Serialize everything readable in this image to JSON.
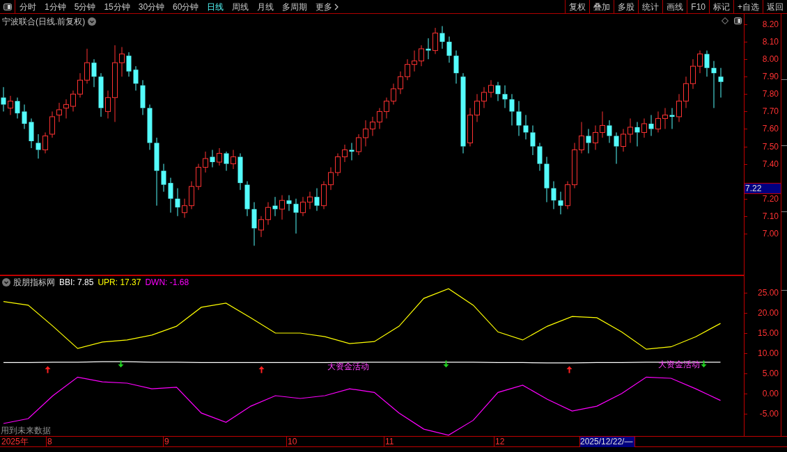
{
  "toolbar": {
    "periods": [
      {
        "label": "分时",
        "selected": false
      },
      {
        "label": "1分钟",
        "selected": false
      },
      {
        "label": "5分钟",
        "selected": false
      },
      {
        "label": "15分钟",
        "selected": false
      },
      {
        "label": "30分钟",
        "selected": false
      },
      {
        "label": "60分钟",
        "selected": false
      },
      {
        "label": "日线",
        "selected": true
      },
      {
        "label": "周线",
        "selected": false
      },
      {
        "label": "月线",
        "selected": false
      },
      {
        "label": "多周期",
        "selected": false
      },
      {
        "label": "更多",
        "selected": false
      }
    ],
    "buttons": [
      "复权",
      "叠加",
      "多股",
      "统计",
      "画线",
      "F10",
      "标记",
      "+自选",
      "返回"
    ]
  },
  "price_pane": {
    "title": "宁波联合(日线.前复权)",
    "current_price": "7.22",
    "chart_data": {
      "type": "candlestick",
      "ylim": [
        6.76,
        8.26
      ],
      "yticks": [
        {
          "value": 8.2,
          "label": "8.20"
        },
        {
          "value": 8.1,
          "label": "8.10"
        },
        {
          "value": 8.0,
          "label": "8.00"
        },
        {
          "value": 7.9,
          "label": "7.90"
        },
        {
          "value": 7.8,
          "label": "7.80"
        },
        {
          "value": 7.7,
          "label": "7.70"
        },
        {
          "value": 7.6,
          "label": "7.60"
        },
        {
          "value": 7.5,
          "label": "7.50"
        },
        {
          "value": 7.4,
          "label": "7.40"
        },
        {
          "value": 7.2,
          "label": "7.20"
        },
        {
          "value": 7.1,
          "label": "7.10"
        },
        {
          "value": 7.0,
          "label": "7.00"
        }
      ],
      "ohlc": [
        [
          7.78,
          7.84,
          7.7,
          7.74
        ],
        [
          7.72,
          7.79,
          7.68,
          7.76
        ],
        [
          7.76,
          7.78,
          7.66,
          7.69
        ],
        [
          7.7,
          7.74,
          7.6,
          7.63
        ],
        [
          7.64,
          7.66,
          7.49,
          7.53
        ],
        [
          7.52,
          7.57,
          7.43,
          7.48
        ],
        [
          7.48,
          7.58,
          7.46,
          7.56
        ],
        [
          7.57,
          7.7,
          7.55,
          7.67
        ],
        [
          7.68,
          7.75,
          7.64,
          7.71
        ],
        [
          7.72,
          7.77,
          7.66,
          7.74
        ],
        [
          7.73,
          7.82,
          7.7,
          7.8
        ],
        [
          7.8,
          7.92,
          7.78,
          7.88
        ],
        [
          7.88,
          8.06,
          7.86,
          7.98
        ],
        [
          7.98,
          8.0,
          7.84,
          7.9
        ],
        [
          7.9,
          7.92,
          7.67,
          7.72
        ],
        [
          7.7,
          7.82,
          7.66,
          7.78
        ],
        [
          7.78,
          8.08,
          7.64,
          7.98
        ],
        [
          7.98,
          8.07,
          7.9,
          8.03
        ],
        [
          8.02,
          8.04,
          7.9,
          7.93
        ],
        [
          7.94,
          7.96,
          7.82,
          7.86
        ],
        [
          7.85,
          7.88,
          7.68,
          7.72
        ],
        [
          7.72,
          7.74,
          7.48,
          7.52
        ],
        [
          7.52,
          7.55,
          7.16,
          7.36
        ],
        [
          7.36,
          7.4,
          7.24,
          7.28
        ],
        [
          7.29,
          7.32,
          7.12,
          7.2
        ],
        [
          7.2,
          7.26,
          7.1,
          7.15
        ],
        [
          7.12,
          7.2,
          7.09,
          7.16
        ],
        [
          7.16,
          7.3,
          7.14,
          7.27
        ],
        [
          7.27,
          7.4,
          7.25,
          7.38
        ],
        [
          7.38,
          7.47,
          7.35,
          7.43
        ],
        [
          7.44,
          7.48,
          7.38,
          7.41
        ],
        [
          7.41,
          7.49,
          7.39,
          7.46
        ],
        [
          7.46,
          7.47,
          7.36,
          7.4
        ],
        [
          7.4,
          7.48,
          7.37,
          7.44
        ],
        [
          7.44,
          7.46,
          7.25,
          7.29
        ],
        [
          7.28,
          7.3,
          7.1,
          7.14
        ],
        [
          7.14,
          7.18,
          6.93,
          7.03
        ],
        [
          7.02,
          7.1,
          6.98,
          7.08
        ],
        [
          7.08,
          7.18,
          7.05,
          7.15
        ],
        [
          7.16,
          7.21,
          7.1,
          7.14
        ],
        [
          7.14,
          7.22,
          7.08,
          7.19
        ],
        [
          7.19,
          7.22,
          7.13,
          7.17
        ],
        [
          7.17,
          7.2,
          7.0,
          7.12
        ],
        [
          7.12,
          7.21,
          7.1,
          7.18
        ],
        [
          7.18,
          7.24,
          7.14,
          7.21
        ],
        [
          7.21,
          7.26,
          7.13,
          7.16
        ],
        [
          7.16,
          7.3,
          7.14,
          7.28
        ],
        [
          7.28,
          7.38,
          7.25,
          7.35
        ],
        [
          7.35,
          7.46,
          7.33,
          7.44
        ],
        [
          7.44,
          7.51,
          7.41,
          7.48
        ],
        [
          7.48,
          7.52,
          7.42,
          7.47
        ],
        [
          7.47,
          7.57,
          7.45,
          7.55
        ],
        [
          7.55,
          7.65,
          7.5,
          7.6
        ],
        [
          7.6,
          7.67,
          7.56,
          7.64
        ],
        [
          7.64,
          7.72,
          7.6,
          7.7
        ],
        [
          7.7,
          7.78,
          7.66,
          7.76
        ],
        [
          7.76,
          7.86,
          7.74,
          7.83
        ],
        [
          7.83,
          7.93,
          7.8,
          7.9
        ],
        [
          7.9,
          8.0,
          7.88,
          7.97
        ],
        [
          7.97,
          8.05,
          7.93,
          7.99
        ],
        [
          7.99,
          8.08,
          7.96,
          8.06
        ],
        [
          8.06,
          8.12,
          8.0,
          8.05
        ],
        [
          8.05,
          8.18,
          8.03,
          8.15
        ],
        [
          8.15,
          8.19,
          8.06,
          8.1
        ],
        [
          8.1,
          8.13,
          7.98,
          8.02
        ],
        [
          8.02,
          8.05,
          7.86,
          7.92
        ],
        [
          7.9,
          7.92,
          7.46,
          7.5
        ],
        [
          7.52,
          7.72,
          7.5,
          7.68
        ],
        [
          7.68,
          7.8,
          7.64,
          7.76
        ],
        [
          7.76,
          7.84,
          7.72,
          7.81
        ],
        [
          7.81,
          7.88,
          7.78,
          7.85
        ],
        [
          7.85,
          7.87,
          7.76,
          7.8
        ],
        [
          7.8,
          7.85,
          7.72,
          7.77
        ],
        [
          7.77,
          7.8,
          7.62,
          7.7
        ],
        [
          7.7,
          7.76,
          7.56,
          7.62
        ],
        [
          7.62,
          7.68,
          7.54,
          7.58
        ],
        [
          7.58,
          7.62,
          7.45,
          7.5
        ],
        [
          7.5,
          7.52,
          7.36,
          7.4
        ],
        [
          7.4,
          7.44,
          7.18,
          7.26
        ],
        [
          7.26,
          7.3,
          7.14,
          7.19
        ],
        [
          7.19,
          7.24,
          7.11,
          7.16
        ],
        [
          7.16,
          7.3,
          7.14,
          7.28
        ],
        [
          7.28,
          7.52,
          7.26,
          7.48
        ],
        [
          7.48,
          7.64,
          7.46,
          7.56
        ],
        [
          7.56,
          7.6,
          7.46,
          7.52
        ],
        [
          7.52,
          7.62,
          7.48,
          7.58
        ],
        [
          7.58,
          7.7,
          7.55,
          7.62
        ],
        [
          7.62,
          7.65,
          7.52,
          7.56
        ],
        [
          7.56,
          7.58,
          7.4,
          7.5
        ],
        [
          7.5,
          7.6,
          7.47,
          7.57
        ],
        [
          7.57,
          7.66,
          7.52,
          7.61
        ],
        [
          7.61,
          7.64,
          7.5,
          7.58
        ],
        [
          7.58,
          7.66,
          7.55,
          7.63
        ],
        [
          7.63,
          7.68,
          7.56,
          7.6
        ],
        [
          7.6,
          7.7,
          7.58,
          7.66
        ],
        [
          7.66,
          7.72,
          7.6,
          7.68
        ],
        [
          7.68,
          7.72,
          7.6,
          7.67
        ],
        [
          7.67,
          7.8,
          7.64,
          7.76
        ],
        [
          7.76,
          7.9,
          7.72,
          7.86
        ],
        [
          7.86,
          8.0,
          7.83,
          7.96
        ],
        [
          7.96,
          8.05,
          7.92,
          8.03
        ],
        [
          8.03,
          8.05,
          7.9,
          7.95
        ],
        [
          7.95,
          7.99,
          7.72,
          7.92
        ],
        [
          7.9,
          7.95,
          7.78,
          7.87
        ]
      ]
    }
  },
  "indicator_pane": {
    "name": "股朋指标网",
    "readouts": [
      {
        "label": "BBI: 7.85",
        "color": "#ffffff"
      },
      {
        "label": "UPR: 17.37",
        "color": "#ffff00"
      },
      {
        "label": "DWN: -1.68",
        "color": "#ff00ff"
      }
    ],
    "chart_data": {
      "type": "line",
      "ylim": [
        -10.5,
        29.3
      ],
      "yticks": [
        {
          "value": 25,
          "label": "25.00"
        },
        {
          "value": 20,
          "label": "20.00"
        },
        {
          "value": 15,
          "label": "15.00"
        },
        {
          "value": 10,
          "label": "10.00"
        },
        {
          "value": 5,
          "label": "5.00"
        },
        {
          "value": 0,
          "label": "0.00"
        },
        {
          "value": -5,
          "label": "-5.00"
        }
      ],
      "series": [
        {
          "color": "#ffff00",
          "values": [
            22.8,
            21.9,
            16.7,
            11.2,
            12.8,
            13.3,
            14.5,
            16.7,
            21.4,
            22.4,
            18.8,
            15.0,
            15.0,
            14.1,
            12.4,
            12.9,
            16.7,
            23.6,
            26.0,
            21.9,
            15.3,
            13.3,
            16.7,
            19.1,
            18.8,
            15.3,
            11.0,
            11.6,
            14.1,
            17.4
          ]
        },
        {
          "color": "#ffffff",
          "values": [
            7.7,
            7.7,
            7.8,
            7.8,
            7.9,
            7.9,
            7.8,
            7.8,
            7.7,
            7.7,
            7.7,
            7.7,
            7.7,
            7.7,
            7.8,
            7.8,
            7.8,
            7.8,
            7.8,
            7.8,
            7.7,
            7.7,
            7.6,
            7.6,
            7.7,
            7.7,
            7.8,
            7.8,
            7.8,
            7.8
          ]
        },
        {
          "color": "#ff00ff",
          "values": [
            -7.4,
            -6.2,
            -0.5,
            4.1,
            2.9,
            2.6,
            1.2,
            1.6,
            -4.8,
            -7.1,
            -3.1,
            -0.5,
            -1.2,
            -0.5,
            1.2,
            0.3,
            -4.8,
            -8.8,
            -10.3,
            -6.6,
            0.3,
            2.1,
            -1.4,
            -4.3,
            -3.1,
            0.0,
            4.1,
            3.8,
            1.2,
            -1.7
          ]
        }
      ],
      "annotations": [
        "大资金活动",
        "大资金活动"
      ]
    },
    "signals": [
      {
        "kind": "up"
      },
      {
        "kind": "down"
      },
      {
        "kind": "up"
      },
      {
        "kind": "down"
      },
      {
        "kind": "up"
      },
      {
        "kind": "down"
      }
    ],
    "warning": "用到未来数据"
  },
  "time_axis": {
    "labels": [
      "2025年",
      "8",
      "9",
      "10",
      "11",
      "12"
    ],
    "cursor_date": "2025/12/22/—"
  }
}
